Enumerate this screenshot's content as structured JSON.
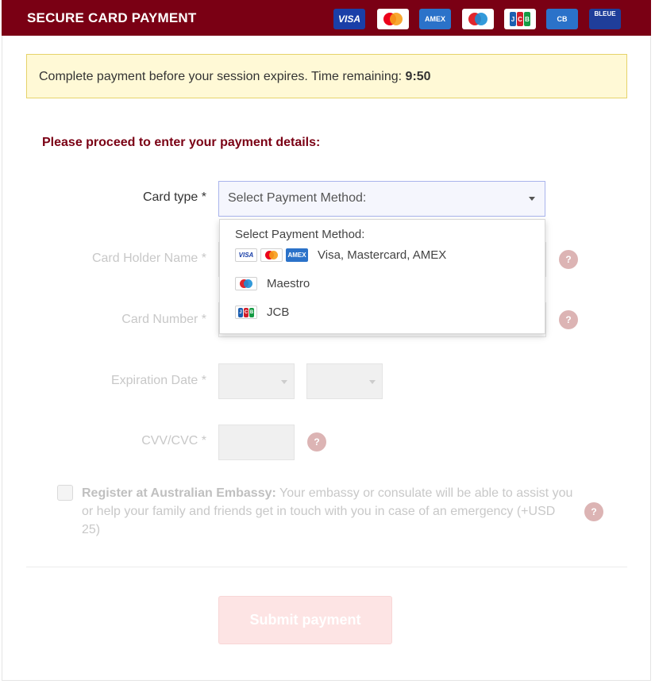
{
  "header": {
    "title": "SECURE CARD PAYMENT",
    "logos": [
      {
        "name": "visa",
        "text": "VISA"
      },
      {
        "name": "mastercard",
        "text": ""
      },
      {
        "name": "amex",
        "text": "AMEX"
      },
      {
        "name": "maestro",
        "text": ""
      },
      {
        "name": "jcb",
        "text": "JCB"
      },
      {
        "name": "cb",
        "text": "CB"
      },
      {
        "name": "carte-bleue",
        "text": "BLEUE"
      }
    ]
  },
  "alert": {
    "text": "Complete payment before your session expires. Time remaining: ",
    "time": "9:50"
  },
  "subtitle": "Please proceed to enter your payment details:",
  "form": {
    "card_type_label": "Card type *",
    "card_type_value": "Select Payment Method:",
    "card_holder_label": "Card Holder Name *",
    "card_number_label": "Card Number *",
    "expiration_label": "Expiration Date *",
    "cvv_label": "CVV/CVC *",
    "help_symbol": "?"
  },
  "dropdown": {
    "header": "Select Payment Method:",
    "options": [
      {
        "label": "Visa, Mastercard, AMEX",
        "icons": [
          "visa",
          "mastercard",
          "amex"
        ]
      },
      {
        "label": "Maestro",
        "icons": [
          "maestro"
        ]
      },
      {
        "label": "JCB",
        "icons": [
          "jcb"
        ]
      }
    ]
  },
  "embassy": {
    "bold": "Register at Australian Embassy:",
    "text": " Your embassy or consulate will be able to assist you or help your family and friends get in touch with you in case of an emergency (+USD 25)"
  },
  "submit_label": "Submit payment",
  "colors": {
    "header_bg": "#7a0014",
    "subtitle": "#7a0014",
    "alert_bg": "#fff9d6",
    "submit_bg": "#fde4e4",
    "help_bg": "#dcb4b4"
  }
}
